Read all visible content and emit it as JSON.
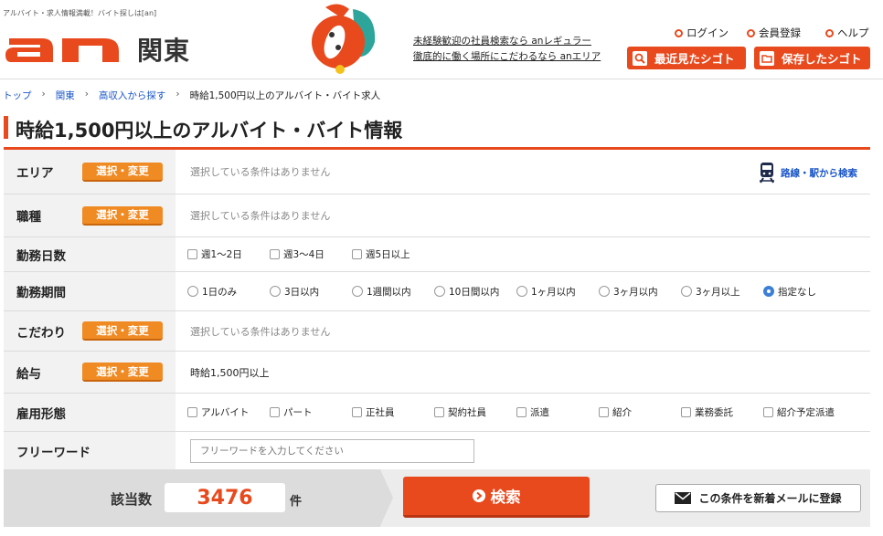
{
  "header": {
    "tagline": "アルバイト・求人情報満載！バイト探しは[an]",
    "region": "関東",
    "promo_links": [
      "未経験歓迎の社員検索なら anレギュラー",
      "徹底的に働く場所にこだわるなら anエリア"
    ],
    "top_links": [
      "ログイン",
      "会員登録",
      "ヘルプ"
    ],
    "buttons": [
      "最近見たシゴト",
      "保存したシゴト"
    ],
    "brand_color": "#e8491d"
  },
  "breadcrumb": [
    "トップ",
    "関東",
    "高収入から探す",
    "時給1,500円以上のアルバイト・バイト求人"
  ],
  "page_title": "時給1,500円以上のアルバイト・バイト情報",
  "form": {
    "change_label": "選択・変更",
    "none_selected": "選択している条件はありません",
    "station_link": "路線・駅から検索",
    "area_label": "エリア",
    "job_label": "職種",
    "days_label": "勤務日数",
    "days_options": [
      "週1〜2日",
      "週3〜4日",
      "週5日以上"
    ],
    "period_label": "勤務期間",
    "period_options": [
      "1日のみ",
      "3日以内",
      "1週間以内",
      "10日間以内",
      "1ヶ月以内",
      "3ヶ月以内",
      "3ヶ月以上",
      "指定なし"
    ],
    "period_selected": "指定なし",
    "kodawari_label": "こだわり",
    "salary_label": "給与",
    "salary_value": "時給1,500円以上",
    "employment_label": "雇用形態",
    "employment_options": [
      "アルバイト",
      "パート",
      "正社員",
      "契約社員",
      "派遣",
      "紹介",
      "業務委託",
      "紹介予定派遣"
    ],
    "freeword_label": "フリーワード",
    "freeword_placeholder": "フリーワードを入力してください",
    "freeword_value": ""
  },
  "result": {
    "count_label": "該当数",
    "count": "3476",
    "count_unit": "件",
    "search_button": "検索",
    "mail_button": "この条件を新着メールに登録"
  }
}
